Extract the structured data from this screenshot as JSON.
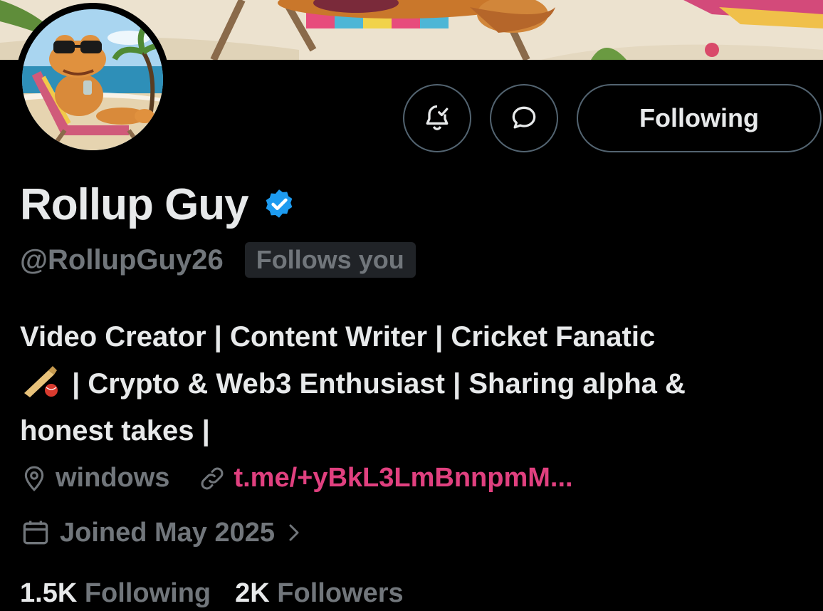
{
  "profile": {
    "display_name": "Rollup Guy",
    "handle": "@RollupGuy26",
    "follows_you": "Follows you",
    "verified": true,
    "bio_line1": "Video Creator | Content Writer | Cricket Fanatic",
    "bio_line2": " | Crypto & Web3 Enthusiast | Sharing alpha &",
    "bio_line3": "honest takes |",
    "location": "windows",
    "link": "t.me/+yBkL3LmBnnpmM...",
    "joined": "Joined May 2025",
    "following_count": "1.5K",
    "following_label": "Following",
    "followers_count": "2K",
    "followers_label": "Followers"
  },
  "actions": {
    "notify_icon": "bell-check-icon",
    "message_icon": "chat-bubble-icon",
    "following_button": "Following"
  },
  "colors": {
    "background": "#000000",
    "text_primary": "#e7e9ea",
    "text_secondary": "#71767b",
    "verified": "#1d9bf0",
    "link": "#e0407f",
    "border": "#536471"
  }
}
